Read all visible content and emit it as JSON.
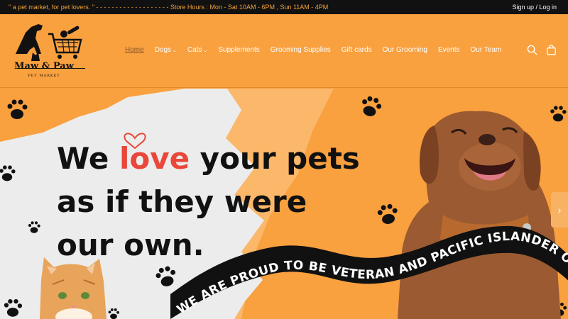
{
  "topbar": {
    "announcement": "\" a pet market, for pet lovers. \" - - - - - - - - - - - - - - - - - - - Store Hours : Mon - Sat 10AM - 6PM , Sun 11AM - 4PM",
    "account": "Sign up / Log in"
  },
  "logo": {
    "name": "Maw & Paw",
    "tagline": "PET MARKET"
  },
  "nav": [
    {
      "label": "Home",
      "active": true,
      "has_menu": false
    },
    {
      "label": "Dogs",
      "active": false,
      "has_menu": true
    },
    {
      "label": "Cats",
      "active": false,
      "has_menu": true
    },
    {
      "label": "Supplements",
      "active": false,
      "has_menu": false
    },
    {
      "label": "Grooming Supplies",
      "active": false,
      "has_menu": false
    },
    {
      "label": "Gift cards",
      "active": false,
      "has_menu": false
    },
    {
      "label": "Our Grooming",
      "active": false,
      "has_menu": false
    },
    {
      "label": "Events",
      "active": false,
      "has_menu": false
    },
    {
      "label": "Our Team",
      "active": false,
      "has_menu": false
    }
  ],
  "header_icons": [
    "search-icon",
    "shopping-bag-icon"
  ],
  "hero": {
    "line1_pre": "We ",
    "line1_love": "love",
    "line1_post": " your pets",
    "line2": "as if they were",
    "line3": "our own.",
    "banner": "WE ARE PROUD TO BE VETERAN AND PACIFIC ISLANDER OWNED.",
    "next_arrow": "›"
  },
  "colors": {
    "brand_orange": "#f9a03f",
    "dark": "#111111",
    "love_red": "#e9473a",
    "paper": "#ececec"
  }
}
